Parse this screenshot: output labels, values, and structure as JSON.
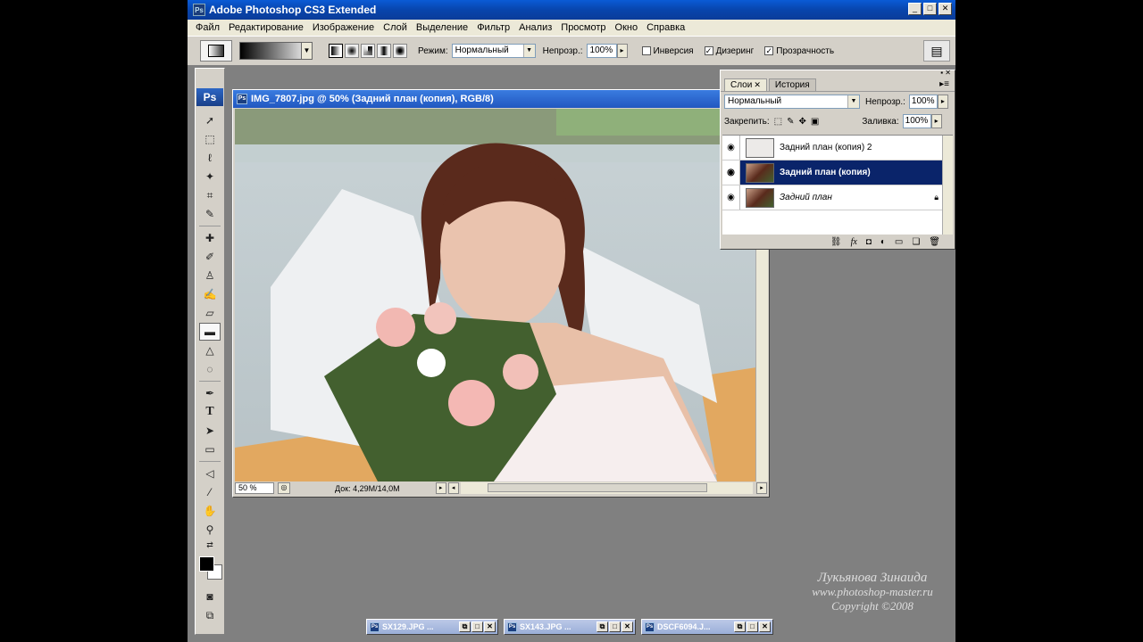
{
  "app": {
    "title": "Adobe Photoshop CS3 Extended",
    "badge": "Ps"
  },
  "window_buttons": {
    "minimize": "_",
    "maximize": "□",
    "close": "✕"
  },
  "menu": [
    "Файл",
    "Редактирование",
    "Изображение",
    "Слой",
    "Выделение",
    "Фильтр",
    "Анализ",
    "Просмотр",
    "Окно",
    "Справка"
  ],
  "options": {
    "mode_label": "Режим:",
    "mode_value": "Нормальный",
    "opacity_label": "Непрозр.:",
    "opacity_value": "100%",
    "invert_label": "Инверсия",
    "invert_checked": false,
    "dither_label": "Дизеринг",
    "dither_checked": true,
    "transparency_label": "Прозрачность",
    "transparency_checked": true
  },
  "toolbox": {
    "logo": "Ps"
  },
  "document": {
    "title": "IMG_7807.jpg @ 50% (Задний план (копия), RGB/8)",
    "zoom": "50 %",
    "doc_info": "Док: 4,29M/14,0M"
  },
  "layers_panel": {
    "tabs": [
      {
        "label": "Слои",
        "active": true
      },
      {
        "label": "История",
        "active": false
      }
    ],
    "blend_mode": "Нормальный",
    "opacity_label": "Непрозр.:",
    "opacity_value": "100%",
    "lock_label": "Закрепить:",
    "fill_label": "Заливка:",
    "fill_value": "100%",
    "layers": [
      {
        "name": "Задний план (копия) 2",
        "selected": false,
        "locked": false
      },
      {
        "name": "Задний план (копия)",
        "selected": true,
        "locked": false
      },
      {
        "name": "Задний план",
        "selected": false,
        "locked": true
      }
    ]
  },
  "minimized_docs": [
    {
      "title": "SX129.JPG ..."
    },
    {
      "title": "SX143.JPG ..."
    },
    {
      "title": "DSCF6094.J..."
    }
  ],
  "watermark": {
    "author": "Лукьянова Зинаида",
    "site": "www.photoshop-master.ru",
    "copyright": "Copyright ©2008"
  },
  "colors": {
    "title_bar": "#0845ad",
    "selected_layer": "#0a246a",
    "workspace": "#808080"
  }
}
